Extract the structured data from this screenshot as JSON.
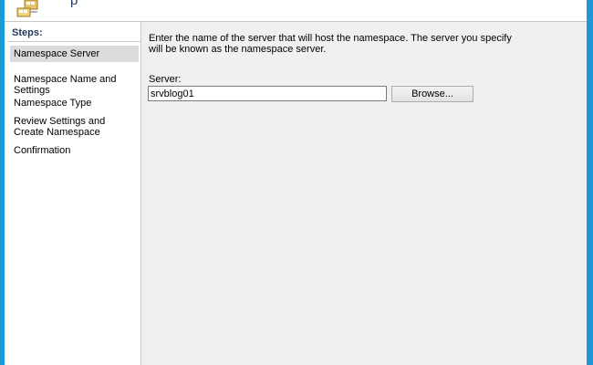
{
  "header": {
    "title": "p"
  },
  "steps": {
    "heading": "Steps:",
    "items": [
      {
        "label": "Namespace Server",
        "active": true
      },
      {
        "label": "Namespace Name and Settings",
        "active": false
      },
      {
        "label": "Namespace Type",
        "active": false
      },
      {
        "label": "Review Settings and Create Namespace",
        "active": false
      },
      {
        "label": "Confirmation",
        "active": false
      }
    ]
  },
  "main": {
    "description": "Enter the name of the server that will host the namespace. The server you specify will be known as the namespace server.",
    "server_label": "Server:",
    "server_value": "srvblog01",
    "browse_label": "Browse..."
  },
  "colors": {
    "window_frame": "#1b9ad6",
    "active_step": "#dadbdc",
    "content_bg": "#f0f0f0"
  },
  "icons": {
    "wizard": "wizard-namespace-icon"
  }
}
